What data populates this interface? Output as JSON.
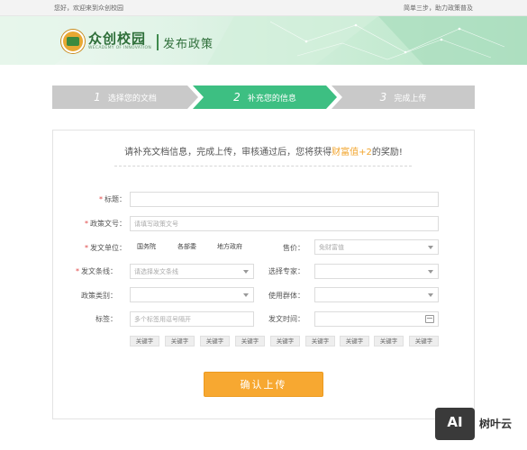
{
  "topbar": {
    "welcome": "您好，欢迎来到众创校园",
    "slogan": "简单三步，助力政策普及"
  },
  "brand": {
    "name": "众创校园",
    "subtitle": "WECADEMY OF INNOVATION",
    "section": "发布政策"
  },
  "steps": [
    {
      "num": "1",
      "label": "选择您的文档"
    },
    {
      "num": "2",
      "label": "补充您的信息"
    },
    {
      "num": "3",
      "label": "完成上传"
    }
  ],
  "intro": {
    "before": "请补充文档信息，完成上传，审核通过后，您将获得",
    "reward": "财富值+2",
    "after": "的奖励!"
  },
  "form": {
    "title_label": "标题：",
    "title_value": "",
    "doc_no_label": "政策文号：",
    "doc_no_placeholder": "请填写政策文号",
    "issuer_label": "发文单位：",
    "issuer_options": [
      "国务院",
      "各部委",
      "地方政府"
    ],
    "price_label": "售价：",
    "price_value": "免财富值",
    "line_label": "发文条线：",
    "line_placeholder": "请选择发文条线",
    "expert_label": "选择专家：",
    "expert_value": "",
    "category_label": "政策类别：",
    "category_value": "",
    "audience_label": "使用群体：",
    "audience_value": "",
    "tags_label": "标签：",
    "tags_placeholder": "多个标签用逗号隔开",
    "date_label": "发文时间：",
    "date_value": ""
  },
  "keyword_tags": [
    "关键字",
    "关键字",
    "关键字",
    "关键字",
    "关键字",
    "关键字",
    "关键字",
    "关键字",
    "关键字"
  ],
  "submit_label": "确认上传",
  "watermark": {
    "badge": "AI",
    "text": "树叶云"
  },
  "colors": {
    "green": "#3dbf82",
    "orange": "#f7a831",
    "gray_step": "#c9c9c9",
    "required": "#e04848"
  },
  "icons": {
    "select": "chevron-down-icon",
    "date": "calendar-icon"
  }
}
